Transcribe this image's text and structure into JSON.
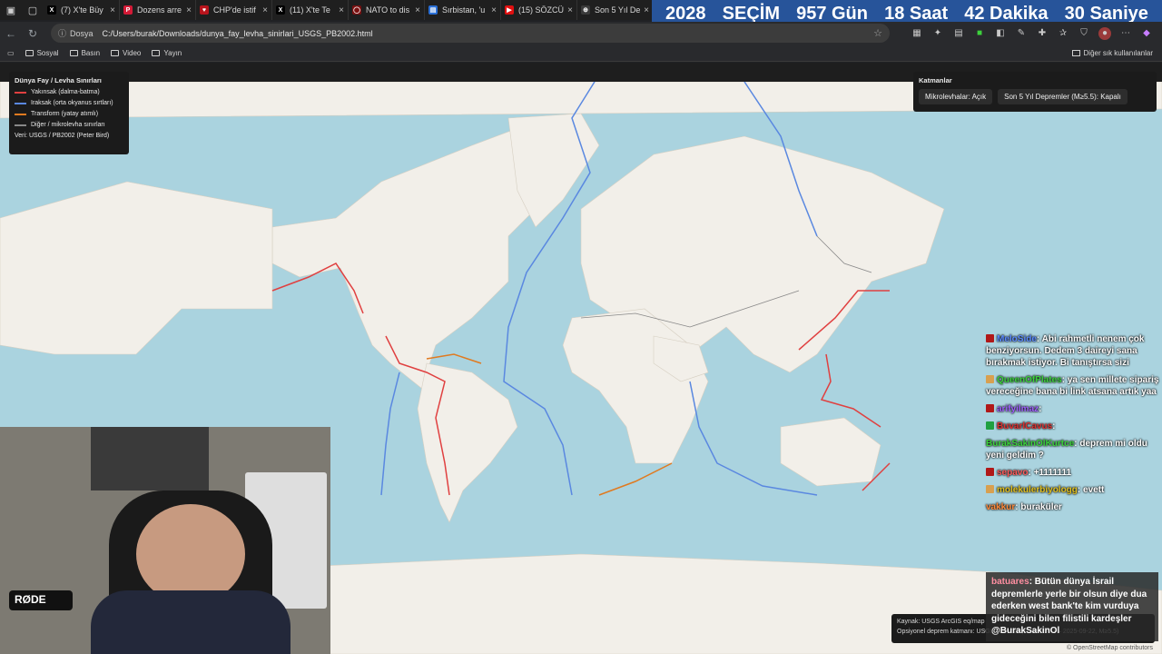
{
  "browser": {
    "tabs": [
      {
        "label": "(7) X'te Büy",
        "color": "#000000",
        "glyph": "X"
      },
      {
        "label": "Dozens arre",
        "color": "#d41a36",
        "glyph": "P"
      },
      {
        "label": "CHP'de istif",
        "color": "#b8141c",
        "glyph": "♥"
      },
      {
        "label": "(11) X'te Te",
        "color": "#000000",
        "glyph": "X"
      },
      {
        "label": "NATO to dis",
        "color": "#7a1010",
        "glyph": "◯"
      },
      {
        "label": "Sırbistan, 'u",
        "color": "#2a6fd6",
        "glyph": "▤"
      },
      {
        "label": "(15) SÖZCÜ",
        "color": "#e01010",
        "glyph": "▶"
      },
      {
        "label": "Son 5 Yıl De",
        "color": "#3a3a3a",
        "glyph": "⊕"
      }
    ],
    "address": {
      "scheme_label": "Dosya",
      "url": "C:/Users/burak/Downloads/dunya_fay_levha_sinirlari_USGS_PB2002.html"
    },
    "bookmarks": [
      "Sosyal",
      "Basın",
      "Video",
      "Yayın"
    ],
    "other_bookmarks": "Diğer sık kullanılanlar"
  },
  "countdown": {
    "year": "2028",
    "label": "SEÇİM",
    "days": "957 Gün",
    "hours": "18 Saat",
    "minutes": "42 Dakika",
    "seconds": "30 Saniye"
  },
  "legend": {
    "title": "Dünya Fay / Levha Sınırları",
    "items": [
      {
        "label": "Yakınsak (dalma-batma)",
        "color": "#e04040"
      },
      {
        "label": "Iraksak (orta okyanus sırtları)",
        "color": "#5a88e0"
      },
      {
        "label": "Transform (yatay atımlı)",
        "color": "#e07a20"
      },
      {
        "label": "Diğer / mikrolevha sınırları",
        "color": "#888888"
      }
    ],
    "source": "Veri: USGS / PB2002 (Peter Bird)"
  },
  "layers": {
    "title": "Katmanlar",
    "microplates": "Mikrolevhalar: Açık",
    "quakes": "Son 5 Yıl Depremler (M≥5.5): Kapalı"
  },
  "source_box": {
    "line1": "Kaynak: USGS ArcGIS eq/map",
    "line2": "Opsiyonel deprem katmanı: USGS ComCat (2020-09-23 – 2025-09-22, M≥5.5)"
  },
  "map_attribution": "© OpenStreetMap contributors",
  "webcam": {
    "mic_brand": "RØDE"
  },
  "chat": [
    {
      "name": "MeloSide",
      "text": "Abi rahmetli nenem çok benziyorsun. Dedem 3 daireyi sana bırakmak istiyor. Bi tanıştırsa sizi",
      "name_color": "#5b8bff",
      "badge": "#b01818"
    },
    {
      "name": "QueenOfPlates",
      "text": "ya sen millete sipariş vereceğine bana bi link atsana artık yaa",
      "name_color": "#3cd23c",
      "badge": "#d8a050"
    },
    {
      "name": "arifyilmaz",
      "text": "",
      "name_color": "#a060ff",
      "badge": "#b01818"
    },
    {
      "name": "BuvarlCavus",
      "text": "",
      "name_color": "#e03030",
      "badge": "#20a040"
    },
    {
      "name": "BurakSakinOlKurtce",
      "text": "deprem mi oldu yeni geldim ?",
      "name_color": "#3cd23c",
      "badge": ""
    },
    {
      "name": "sepavo",
      "text": "+1111111",
      "name_color": "#ff5a5a",
      "badge": "#b01818"
    },
    {
      "name": "molekulerbiyologg",
      "text": "evett",
      "name_color": "#e0c020",
      "badge": "#d8a050"
    },
    {
      "name": "vakkur",
      "text": "buraküler",
      "name_color": "#ff8a3a",
      "badge": ""
    }
  ],
  "last_message": {
    "name": "batuares",
    "text": "Bütün dünya İsrail depremlerle yerle bir olsun diye dua ederken west bank'te kim vurduya gideceğini bilen filistili kardeşler @BurakSakinOl"
  }
}
